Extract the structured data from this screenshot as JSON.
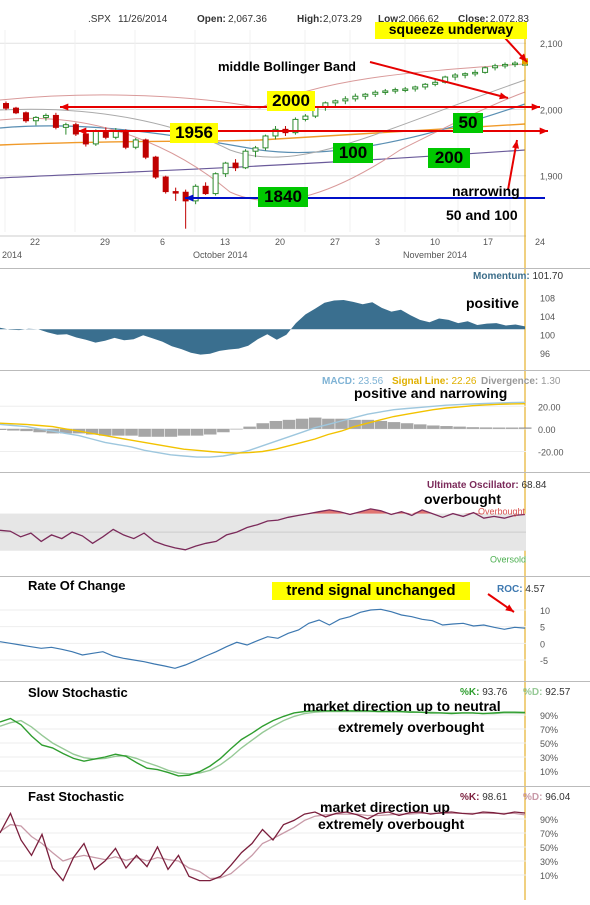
{
  "colors": {
    "candle_up": "#2e8b2e",
    "candle_down": "#c00000",
    "momentum_fill": "#3a6f8f",
    "macd_line": "#9ec7de",
    "signal_line": "#f2c200",
    "divergence": "#888888",
    "ult_line": "#7b2a5a",
    "ult_fill": "#d9534f",
    "roc_line": "#3d78b0",
    "slow_k": "#2f9e2f",
    "slow_d": "#96c996",
    "fast_k": "#7b1f3d",
    "fast_d": "#c89aa8",
    "annotation_red": "#e60000",
    "annotation_blue": "#0010c8",
    "callout_yellow": "#ffff00",
    "callout_green": "#00c800",
    "current_marker": "#e0a000"
  },
  "header": {
    "symbol": ".SPX",
    "date": "11/26/2014",
    "open_label": "Open:",
    "open": "2,067.36",
    "high_label": "High:",
    "high": "2,073.29",
    "low_label": "Low:",
    "low": "2,066.62",
    "close_label": "Close:",
    "close": "2,072.83"
  },
  "annotations": {
    "squeeze": "squeeze underway",
    "middle_bb": "middle Bollinger Band",
    "l2000": "2000",
    "l1956": "1956",
    "l50": "50",
    "l100": "100",
    "l200": "200",
    "l1840": "1840",
    "narrowing": "narrowing",
    "narrowing2": "50 and 100",
    "positive": "positive",
    "macd_note": "positive and narrowing",
    "overbought": "overbought",
    "roc_note": "trend signal unchanged",
    "slow_note1": "market direction up to neutral",
    "slow_note2": "extremely overbought",
    "fast_note1": "market direction up",
    "fast_note2": "extremely overbought"
  },
  "chart_data": [
    {
      "type": "candlestick",
      "title": ".SPX 11/26/2014",
      "x_tick_labels": [
        "22",
        "29",
        "6",
        "13",
        "20",
        "27",
        "3",
        "10",
        "17",
        "24"
      ],
      "x_group_labels": [
        "2014",
        "October 2014",
        "November 2014"
      ],
      "y_tick_labels": [
        "2,100",
        "2,000",
        "1,900"
      ],
      "ylim": [
        1815,
        2120
      ],
      "ohlc": [
        [
          2009,
          2012,
          1999,
          2002
        ],
        [
          2002,
          2004,
          1993,
          1995
        ],
        [
          1995,
          1997,
          1980,
          1983
        ],
        [
          1983,
          1990,
          1976,
          1988
        ],
        [
          1988,
          1994,
          1983,
          1991
        ],
        [
          1991,
          1995,
          1970,
          1973
        ],
        [
          1973,
          1980,
          1962,
          1977
        ],
        [
          1977,
          1980,
          1960,
          1963
        ],
        [
          1963,
          1966,
          1944,
          1948
        ],
        [
          1948,
          1970,
          1945,
          1967
        ],
        [
          1967,
          1973,
          1955,
          1958
        ],
        [
          1958,
          1972,
          1955,
          1968
        ],
        [
          1968,
          1970,
          1940,
          1943
        ],
        [
          1943,
          1957,
          1940,
          1954
        ],
        [
          1954,
          1956,
          1925,
          1928
        ],
        [
          1928,
          1930,
          1895,
          1898
        ],
        [
          1898,
          1900,
          1873,
          1876
        ],
        [
          1876,
          1882,
          1862,
          1875
        ],
        [
          1875,
          1879,
          1820,
          1862
        ],
        [
          1862,
          1887,
          1857,
          1884
        ],
        [
          1884,
          1890,
          1871,
          1873
        ],
        [
          1873,
          1905,
          1870,
          1903
        ],
        [
          1903,
          1921,
          1898,
          1919
        ],
        [
          1919,
          1925,
          1907,
          1912
        ],
        [
          1912,
          1940,
          1910,
          1937
        ],
        [
          1937,
          1945,
          1928,
          1942
        ],
        [
          1942,
          1962,
          1938,
          1960
        ],
        [
          1960,
          1975,
          1955,
          1970
        ],
        [
          1970,
          1975,
          1960,
          1965
        ],
        [
          1965,
          1988,
          1962,
          1985
        ],
        [
          1985,
          1993,
          1982,
          1990
        ],
        [
          1990,
          2005,
          1987,
          2003
        ],
        [
          2003,
          2012,
          1998,
          2010
        ],
        [
          2010,
          2015,
          2004,
          2013
        ],
        [
          2013,
          2020,
          2008,
          2016
        ],
        [
          2016,
          2024,
          2012,
          2020
        ],
        [
          2020,
          2025,
          2015,
          2023
        ],
        [
          2023,
          2029,
          2019,
          2026
        ],
        [
          2026,
          2031,
          2022,
          2028
        ],
        [
          2028,
          2033,
          2024,
          2030
        ],
        [
          2030,
          2034,
          2026,
          2031
        ],
        [
          2031,
          2036,
          2027,
          2034
        ],
        [
          2034,
          2040,
          2030,
          2038
        ],
        [
          2038,
          2046,
          2035,
          2041
        ],
        [
          2041,
          2051,
          2039,
          2049
        ],
        [
          2049,
          2055,
          2044,
          2052
        ],
        [
          2052,
          2056,
          2047,
          2054
        ],
        [
          2054,
          2060,
          2050,
          2056
        ],
        [
          2056,
          2065,
          2054,
          2063
        ],
        [
          2063,
          2069,
          2059,
          2066
        ],
        [
          2066,
          2071,
          2062,
          2068
        ],
        [
          2068,
          2073,
          2064,
          2070
        ],
        [
          2067,
          2073,
          2066,
          2073
        ]
      ],
      "sma50_pct": [
        [
          "ma50",
          "points"
        ]
      ],
      "reference_levels": [
        2000,
        1956,
        1840
      ]
    },
    {
      "type": "area",
      "title": "Momentum",
      "value_label": "101.70",
      "y_tick_labels": [
        "108",
        "104",
        "100",
        "96"
      ],
      "ylim": [
        94,
        110
      ],
      "baseline": 101.1,
      "values": [
        101.4,
        101.0,
        100.9,
        101.2,
        101.1,
        100.4,
        99.9,
        100.0,
        99.3,
        98.8,
        98.2,
        98.6,
        99.2,
        98.7,
        98.9,
        99.8,
        99.1,
        98.4,
        97.4,
        96.8,
        96.0,
        95.6,
        95.8,
        96.4,
        96.7,
        96.9,
        97.5,
        98.9,
        100.0,
        98.8,
        99.9,
        102.4,
        104.3,
        105.5,
        106.8,
        107.3,
        107.4,
        107.0,
        106.5,
        106.9,
        105.7,
        104.9,
        105.3,
        104.1,
        103.1,
        102.6,
        103.4,
        103.1,
        102.4,
        102.8,
        102.0,
        102.3,
        102.4,
        101.9,
        102.1,
        101.7
      ]
    },
    {
      "type": "line",
      "title": "MACD",
      "value_label": "23.56",
      "signal_label": "Signal Line:",
      "signal_value": "22.26",
      "divergence_label": "Divergence:",
      "divergence_value": "1.30",
      "y_tick_labels": [
        "20.00",
        "0.00",
        "-20.00"
      ],
      "ylim": [
        -32,
        30
      ],
      "series": [
        {
          "name": "MACD",
          "values": [
            4,
            3,
            2,
            0,
            -2,
            -4,
            -6,
            -9,
            -12,
            -14,
            -16,
            -19,
            -21,
            -23,
            -24,
            -25,
            -25,
            -24,
            -22,
            -19,
            -15,
            -11,
            -7,
            -3,
            1,
            4,
            7,
            10,
            13,
            15,
            17,
            18,
            19,
            20,
            21,
            21.5,
            22,
            22.5,
            23,
            23.3,
            23.56
          ]
        },
        {
          "name": "Signal Line",
          "values": [
            5,
            4.5,
            4,
            3,
            2,
            0,
            -2,
            -4,
            -6,
            -8,
            -10,
            -12,
            -14,
            -16,
            -18,
            -19,
            -20,
            -21,
            -21.5,
            -21,
            -20,
            -18,
            -15,
            -12,
            -9,
            -5,
            -2,
            2,
            5,
            8,
            11,
            13,
            15,
            17,
            18.5,
            19.5,
            20.5,
            21.2,
            21.8,
            22.1,
            22.26
          ]
        }
      ],
      "divergence": [
        -1,
        -1.5,
        -2,
        -3,
        -4,
        -4,
        -4,
        -5,
        -6,
        -6,
        -6,
        -7,
        -7,
        -7,
        -6,
        -6,
        -5,
        -3,
        -0.5,
        2,
        5,
        7,
        8,
        9,
        10,
        9,
        9,
        8,
        8,
        7,
        6,
        5,
        4,
        3,
        2.5,
        2,
        1.5,
        1.3,
        1.2,
        1.2,
        1.3
      ]
    },
    {
      "type": "line",
      "title": "Ultimate Oscillator",
      "value_label": "68.84",
      "band_labels": [
        "Overbought",
        "Oversold"
      ],
      "ylim": [
        20,
        90
      ],
      "overbought": 70,
      "oversold": 30,
      "values": [
        52,
        51,
        45,
        49,
        40,
        47,
        43,
        50,
        46,
        38,
        45,
        53,
        47,
        43,
        49,
        40,
        36,
        33,
        31,
        35,
        38,
        40,
        47,
        50,
        55,
        58,
        62,
        63,
        66,
        68,
        70,
        72,
        74,
        72,
        69,
        72,
        75,
        73,
        69,
        72,
        68,
        74,
        70,
        66,
        70,
        67,
        71,
        65,
        67,
        65,
        68,
        69
      ]
    },
    {
      "type": "line",
      "title": "Rate Of Change",
      "value_label": "4.57",
      "y_tick_labels": [
        "10",
        "5",
        "0",
        "-5"
      ],
      "ylim": [
        -8,
        13
      ],
      "values": [
        0.5,
        0.0,
        -0.5,
        -1.0,
        -1.5,
        -1.2,
        -1.8,
        -2.5,
        -3.5,
        -3.0,
        -2.5,
        -3.8,
        -4.5,
        -5.0,
        -5.5,
        -6.2,
        -6.8,
        -7.5,
        -6.5,
        -5.2,
        -3.8,
        -2.5,
        -1.0,
        0.3,
        -0.5,
        0.8,
        2.0,
        1.5,
        3.0,
        4.0,
        6.0,
        7.0,
        5.5,
        7.2,
        8.0,
        9.3,
        10.0,
        10.2,
        9.5,
        8.5,
        8.0,
        7.2,
        6.8,
        5.5,
        5.8,
        6.0,
        5.2,
        5.5,
        4.8,
        4.2,
        4.8,
        4.57
      ]
    },
    {
      "type": "line",
      "title": "Slow Stochastic",
      "k_label": "%K:",
      "k_value": "93.76",
      "d_label": "%D:",
      "d_value": "92.57",
      "y_tick_labels": [
        "90%",
        "70%",
        "50%",
        "30%",
        "10%"
      ],
      "ylim": [
        0,
        100
      ],
      "series": [
        {
          "name": "%K",
          "values": [
            80,
            85,
            76,
            60,
            47,
            43,
            35,
            28,
            24,
            27,
            30,
            34,
            31,
            22,
            14,
            12,
            8,
            3,
            4,
            9,
            17,
            28,
            42,
            55,
            64,
            74,
            82,
            88,
            93,
            95,
            96,
            96,
            96,
            96,
            96,
            96,
            95,
            95,
            95,
            94,
            94,
            93,
            93,
            92,
            93,
            93,
            92,
            93,
            94,
            94,
            93.76
          ]
        },
        {
          "name": "%D",
          "values": [
            74,
            79,
            82,
            73,
            61,
            50,
            42,
            34,
            29,
            27,
            28,
            31,
            32,
            28,
            22,
            17,
            11,
            7,
            6,
            7,
            11,
            19,
            30,
            43,
            54,
            65,
            74,
            82,
            88,
            92,
            94,
            95,
            95,
            95,
            95,
            95,
            95,
            95,
            95,
            95,
            94,
            94,
            93,
            93,
            93,
            93,
            92,
            92,
            93,
            93,
            92.57
          ]
        }
      ]
    },
    {
      "type": "line",
      "title": "Fast Stochastic",
      "k_label": "%K:",
      "k_value": "98.61",
      "d_label": "%D:",
      "d_value": "96.04",
      "y_tick_labels": [
        "90%",
        "70%",
        "50%",
        "30%",
        "10%"
      ],
      "ylim": [
        0,
        100
      ],
      "series": [
        {
          "name": "%K",
          "values": [
            70,
            98,
            60,
            38,
            68,
            20,
            2,
            35,
            55,
            18,
            30,
            48,
            20,
            38,
            22,
            50,
            18,
            38,
            8,
            2,
            2,
            8,
            24,
            42,
            55,
            75,
            60,
            82,
            88,
            97,
            100,
            93,
            98,
            100,
            96,
            90,
            98,
            100,
            95,
            99,
            100,
            97,
            99,
            100,
            98,
            97,
            100,
            99,
            97,
            100,
            98.61
          ]
        },
        {
          "name": "%D",
          "values": [
            72,
            82,
            80,
            65,
            55,
            42,
            30,
            35,
            38,
            35,
            32,
            36,
            31,
            35,
            30,
            35,
            32,
            30,
            20,
            15,
            5,
            6,
            12,
            25,
            38,
            55,
            62,
            70,
            78,
            88,
            94,
            96,
            97,
            97,
            97,
            95,
            95,
            96,
            97,
            97,
            98,
            98,
            98,
            98,
            98,
            98,
            98,
            98,
            98,
            98,
            96.04
          ]
        }
      ]
    }
  ]
}
